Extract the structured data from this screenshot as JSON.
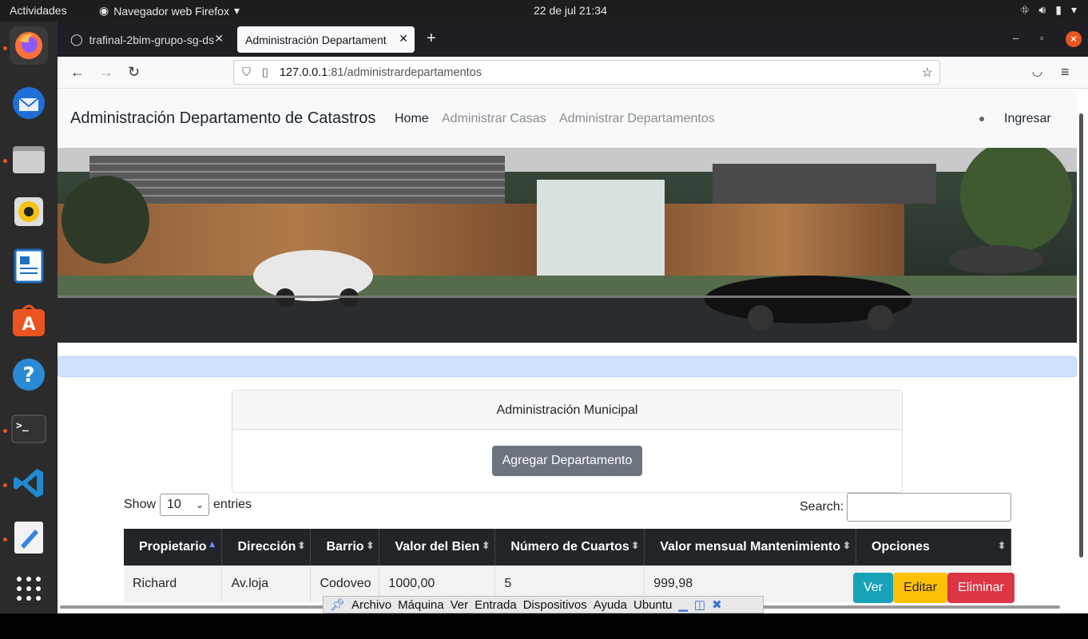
{
  "topbar": {
    "activities": "Actividades",
    "app_name": "Navegador web Firefox",
    "clock": "22 de jul  21:34"
  },
  "browser": {
    "tabs": [
      {
        "label": "trafinal-2bim-grupo-sg-ds"
      },
      {
        "label": "Administración Departament"
      }
    ],
    "url_host": "127.0.0.1",
    "url_rest": ":81/administrardepartamentos"
  },
  "site": {
    "brand": "Administración Departamento de Catastros",
    "nav": [
      "Home",
      "Administrar Casas",
      "Administrar Departamentos"
    ],
    "login": "Ingresar",
    "card_title": "Administración Municipal",
    "add_button": "Agregar Departamento",
    "show_label": "Show",
    "entries_value": "10",
    "entries_label": "entries",
    "search_label": "Search:",
    "columns": [
      "Propietario",
      "Dirección",
      "Barrio",
      "Valor del Bien",
      "Número de Cuartos",
      "Valor mensual Mantenimiento",
      "Opciones"
    ],
    "rows": [
      [
        "Richard",
        "Av.loja",
        "Codoveo",
        "1000,00",
        "5",
        "999,98"
      ]
    ],
    "actions": [
      "Ver",
      "Editar",
      "Eliminar"
    ]
  },
  "vbox_menu": [
    "Archivo",
    "Máquina",
    "Ver",
    "Entrada",
    "Dispositivos",
    "Ayuda",
    "Ubuntu"
  ],
  "colors": {
    "ver": "#17a2b8",
    "editar": "#ffc107",
    "eliminar": "#dc3545",
    "accent": "#e95420"
  }
}
